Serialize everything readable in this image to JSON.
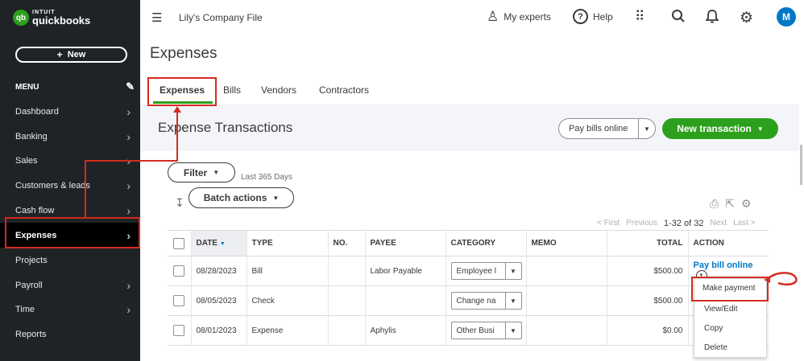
{
  "sidebar": {
    "brand_top": "INTUIT",
    "brand_name": "quickbooks",
    "brand_mark": "qb",
    "new_button": "New",
    "menu_label": "MENU",
    "items": [
      {
        "label": "Dashboard",
        "chevron": true
      },
      {
        "label": "Banking",
        "chevron": true
      },
      {
        "label": "Sales",
        "chevron": true
      },
      {
        "label": "Customers & leads",
        "chevron": true
      },
      {
        "label": "Cash flow",
        "chevron": true
      },
      {
        "label": "Expenses",
        "chevron": true,
        "active": true
      },
      {
        "label": "Projects",
        "chevron": false
      },
      {
        "label": "Payroll",
        "chevron": true
      },
      {
        "label": "Time",
        "chevron": true
      },
      {
        "label": "Reports",
        "chevron": false
      }
    ]
  },
  "topbar": {
    "company": "Lily's Company File",
    "experts": "My experts",
    "help": "Help",
    "avatar": "M"
  },
  "page": {
    "title": "Expenses",
    "tabs": [
      "Expenses",
      "Bills",
      "Vendors",
      "Contractors"
    ],
    "section_title": "Expense Transactions",
    "pay_bills_online": "Pay bills online",
    "new_transaction": "New transaction",
    "filter": "Filter",
    "filter_range": "Last 365 Days",
    "batch_actions": "Batch actions",
    "pager": {
      "first": "< First",
      "previous": "Previous",
      "range": "1-32 of 32",
      "next": "Next",
      "last": "Last >"
    }
  },
  "table": {
    "headers": {
      "date": "DATE",
      "type": "TYPE",
      "no": "NO.",
      "payee": "PAYEE",
      "category": "CATEGORY",
      "memo": "MEMO",
      "total": "TOTAL",
      "action": "ACTION"
    },
    "sort_indicator": "▼",
    "rows": [
      {
        "date": "08/28/2023",
        "type": "Bill",
        "no": "",
        "payee": "Labor Payable",
        "category": "Employee l",
        "memo": "",
        "total": "$500.00",
        "action": "Pay bill online"
      },
      {
        "date": "08/05/2023",
        "type": "Check",
        "no": "",
        "payee": "",
        "category": "Change na",
        "memo": "",
        "total": "$500.00",
        "action": ""
      },
      {
        "date": "08/01/2023",
        "type": "Expense",
        "no": "",
        "payee": "Aphylis",
        "category": "Other Busi",
        "memo": "",
        "total": "$0.00",
        "action": ""
      }
    ]
  },
  "dropdown": {
    "items": [
      "Make payment",
      "View/Edit",
      "Copy",
      "Delete"
    ]
  },
  "colors": {
    "sidebar_bg": "#1f2326",
    "brand_green": "#2ca01c",
    "link_blue": "#0077c5",
    "highlight_red": "#d52b1e"
  },
  "icons": [
    "hamburger-icon",
    "experts-icon",
    "help-icon",
    "apps-grid-icon",
    "search-icon",
    "bell-icon",
    "gear-icon",
    "pencil-icon",
    "print-icon",
    "export-icon",
    "settings-icon",
    "sort-icon"
  ]
}
